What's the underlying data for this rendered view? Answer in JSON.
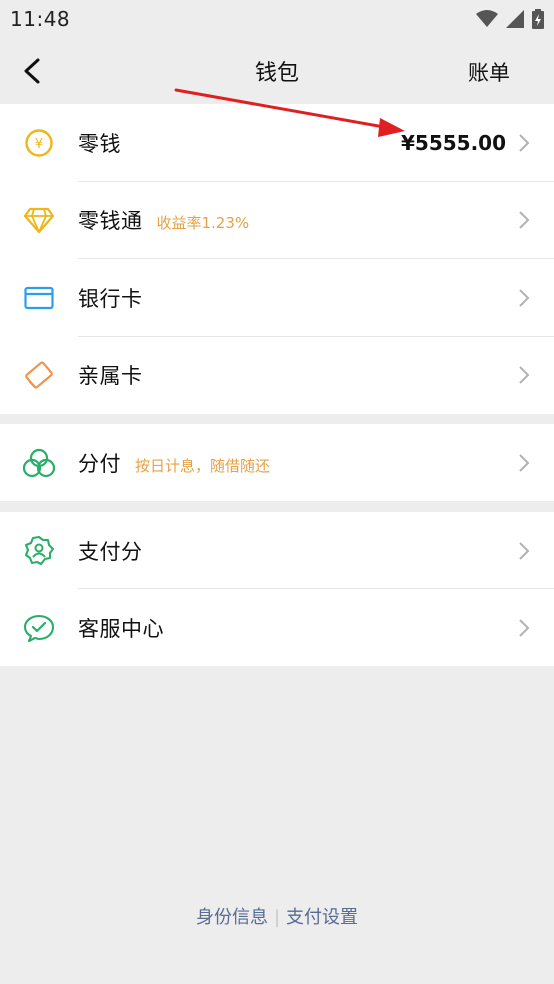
{
  "status_bar": {
    "time": "11:48",
    "icons": [
      "wifi-icon",
      "signal-icon",
      "battery-icon"
    ]
  },
  "nav": {
    "title": "钱包",
    "right_action": "账单"
  },
  "wallet_items": [
    {
      "label": "零钱",
      "value": "¥5555.00",
      "icon": "coin-yen-icon"
    },
    {
      "label": "零钱通",
      "sub": "收益率1.23%",
      "icon": "diamond-icon"
    },
    {
      "label": "银行卡",
      "icon": "bank-card-icon"
    },
    {
      "label": "亲属卡",
      "icon": "family-card-icon"
    }
  ],
  "credit_items": [
    {
      "label": "分付",
      "sub": "按日计息，随借随还",
      "icon": "fenfu-icon"
    }
  ],
  "service_items": [
    {
      "label": "支付分",
      "icon": "pay-score-icon"
    },
    {
      "label": "客服中心",
      "icon": "customer-service-icon"
    }
  ],
  "footer": {
    "identity_link": "身份信息",
    "separator": "|",
    "settings_link": "支付设置"
  },
  "colors": {
    "background": "#ededed",
    "accent_orange": "#e6a146",
    "green": "#2aae67",
    "blue": "#2d9ee8",
    "link": "#576b95",
    "annotation_red": "#e02020"
  }
}
